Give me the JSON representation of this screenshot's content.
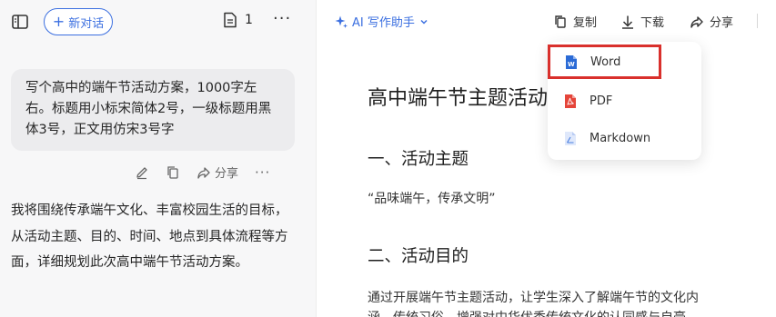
{
  "sidebar": {
    "new_chat_label": "新对话",
    "doc_count": "1"
  },
  "conversation": {
    "user_message": "写个高中的端午节活动方案，1000字左右。标题用小标宋简体2号，一级标题用黑体3号，正文用仿宋3号字",
    "share_label": "分享",
    "assistant_message": "我将围绕传承端午文化、丰富校园生活的目标，从活动主题、目的、时间、地点到具体流程等方面，详细规划此次高中端午节活动方案。"
  },
  "toolbar": {
    "ai_assistant_label": "AI 写作助手",
    "copy_label": "复制",
    "download_label": "下载",
    "share_label": "分享"
  },
  "document": {
    "title": "高中端午节主题活动方案",
    "section1_heading": "一、活动主题",
    "section1_body": "“品味端午，传承文明”",
    "section2_heading": "二、活动目的",
    "section2_line1": "通过开展端午节主题活动，让学生深入了解端午节的文化内",
    "section2_line2": "涵、传统习俗，增强对中华优秀传统文化的认同感与自豪"
  },
  "download_menu": {
    "items": [
      {
        "label": "Word",
        "icon": "word-file-icon",
        "selected": true
      },
      {
        "label": "PDF",
        "icon": "pdf-file-icon",
        "selected": false
      },
      {
        "label": "Markdown",
        "icon": "markdown-file-icon",
        "selected": false
      }
    ]
  },
  "colors": {
    "accent": "#3b6fe0",
    "highlight_border": "#d9302c",
    "word": "#2b6bd6",
    "pdf": "#e5453a",
    "markdown": "#4a7fe0"
  }
}
